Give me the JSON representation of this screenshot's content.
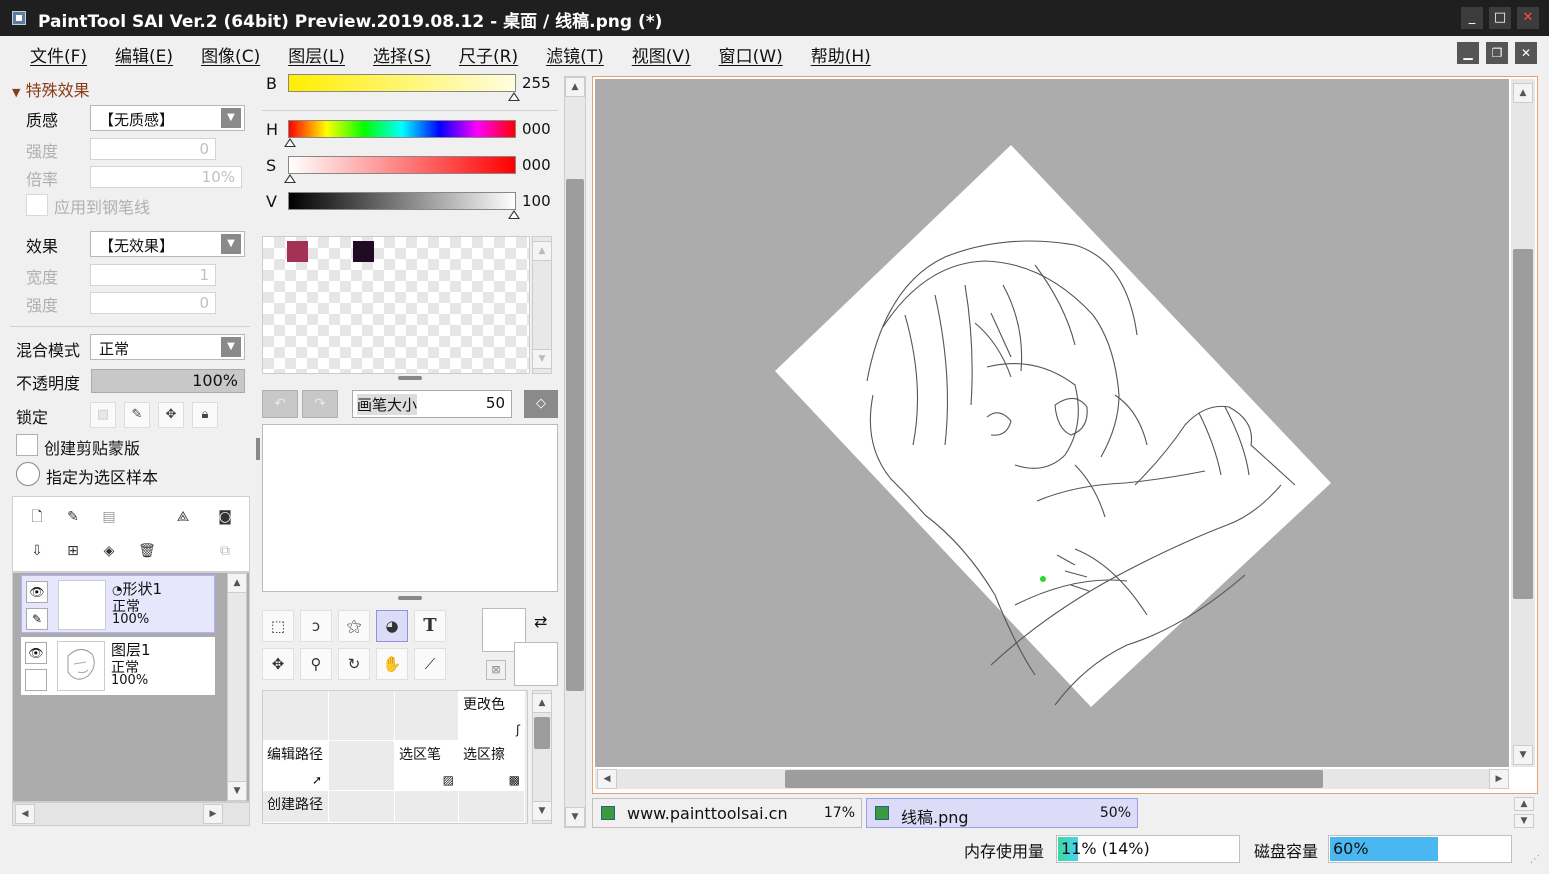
{
  "window": {
    "title": "PaintTool SAI Ver.2 (64bit) Preview.2019.08.12 - 桌面 / 线稿.png (*)",
    "minimize": "_",
    "maximize": "□",
    "close": "✕"
  },
  "menu": [
    "文件(F)",
    "编辑(E)",
    "图像(C)",
    "图层(L)",
    "选择(S)",
    "尺子(R)",
    "滤镜(T)",
    "视图(V)",
    "窗口(W)",
    "帮助(H)"
  ],
  "effects": {
    "section_title": "特殊效果",
    "texture_label": "质感",
    "texture_value": "【无质感】",
    "strength_label": "强度",
    "strength_value": "0",
    "scale_label": "倍率",
    "scale_value": "10%",
    "apply_pen_label": "应用到钢笔线",
    "effect_label": "效果",
    "effect_value": "【无效果】",
    "width_label": "宽度",
    "width_value": "1",
    "strength2_label": "强度",
    "strength2_value": "0"
  },
  "layer_props": {
    "blend_label": "混合模式",
    "blend_value": "正常",
    "opacity_label": "不透明度",
    "opacity_value": "100%",
    "lock_label": "锁定",
    "clip_label": "创建剪贴蒙版",
    "sample_label": "指定为选区样本"
  },
  "layers": [
    {
      "name": "形状1",
      "mode": "正常",
      "opacity": "100%",
      "selected": true
    },
    {
      "name": "图层1",
      "mode": "正常",
      "opacity": "100%",
      "selected": false
    }
  ],
  "color": {
    "b_label": "B",
    "b_value": "255",
    "h_label": "H",
    "h_value": "000",
    "s_label": "S",
    "s_value": "000",
    "v_label": "V",
    "v_value": "100",
    "swatch1": "#a33257",
    "swatch2": "#220a25"
  },
  "brush": {
    "size_label": "画笔大小",
    "size_value": "50"
  },
  "tool_grid": {
    "change_color": "更改色",
    "edit_path": "编辑路径",
    "select_pen": "选区笔",
    "select_eraser": "选区擦",
    "create_path": "创建路径"
  },
  "tabs": [
    {
      "name": "www.painttoolsai.cn",
      "zoom": "17%"
    },
    {
      "name": "线稿.png",
      "zoom": "50%"
    }
  ],
  "status": {
    "memory_label": "内存使用量",
    "memory_value": "11% (14%)",
    "memory_fraction": 0.11,
    "disk_label": "磁盘容量",
    "disk_value": "60%",
    "disk_fraction": 0.6
  },
  "colors": {
    "accent": "#dcdcf8",
    "memory_fill": "#3dd8a0",
    "disk_fill": "#4ab8f0"
  }
}
